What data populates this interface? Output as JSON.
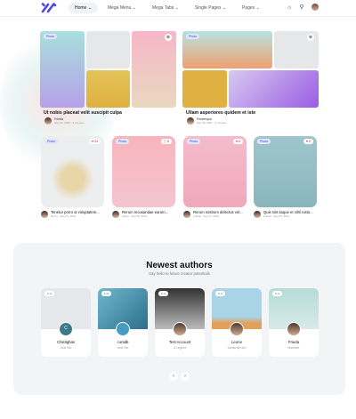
{
  "nav": {
    "items": [
      "Home",
      "Mega Menu",
      "Mega Tabs",
      "Single Pages",
      "Pages"
    ],
    "active": "Home"
  },
  "featured": [
    {
      "tag": "Photo",
      "title": "Ut nobis placeat velit suscipit culpa",
      "author": "Frieda",
      "date": "Sep 04, 2021 · 3 minutes"
    },
    {
      "tag": "Photo",
      "title": "Ullam asperiores quidem et iste",
      "author": "Frederique",
      "date": "Sep 08, 2021 · 3 minutes"
    }
  ],
  "cards": [
    {
      "tag": "Photo",
      "count": "34",
      "title": "Tenetur porro ut voluptatem...",
      "author": "Bryon",
      "date": "Sep 01, 2021"
    },
    {
      "tag": "Photo",
      "count": "8",
      "title": "Rerum recusandae earum...",
      "author": "Aidan",
      "date": "Sep 09, 2021"
    },
    {
      "tag": "Photo",
      "count": "6",
      "title": "Rerum nostrum delectus vel...",
      "author": "Frieda",
      "date": "Sep 17, 2021"
    },
    {
      "tag": "Photo",
      "count": "6",
      "title": "Quis sint itaque et nihil iusto...",
      "author": "Frieda",
      "date": "Sep 23, 2021"
    }
  ],
  "authors_section": {
    "title": "Newest authors",
    "subtitle": "Say hello to future creator potentials"
  },
  "authors": [
    {
      "name": "Chistighas",
      "bio": "User Bio",
      "badge": "0",
      "initial": "C"
    },
    {
      "name": "contdb",
      "bio": "User Bio",
      "badge": "0"
    },
    {
      "name": "Test Account",
      "bio": "A Legend",
      "badge": "0"
    },
    {
      "name": "Leone",
      "bio": "Javascript dev",
      "badge": "0"
    },
    {
      "name": "Frieda",
      "bio": "Marketer",
      "badge": "0"
    }
  ],
  "pagination": {
    "prev": "‹",
    "next": "›"
  },
  "colors": {
    "brand": "#4f46e5",
    "section_bg": "#f3f4f6"
  }
}
